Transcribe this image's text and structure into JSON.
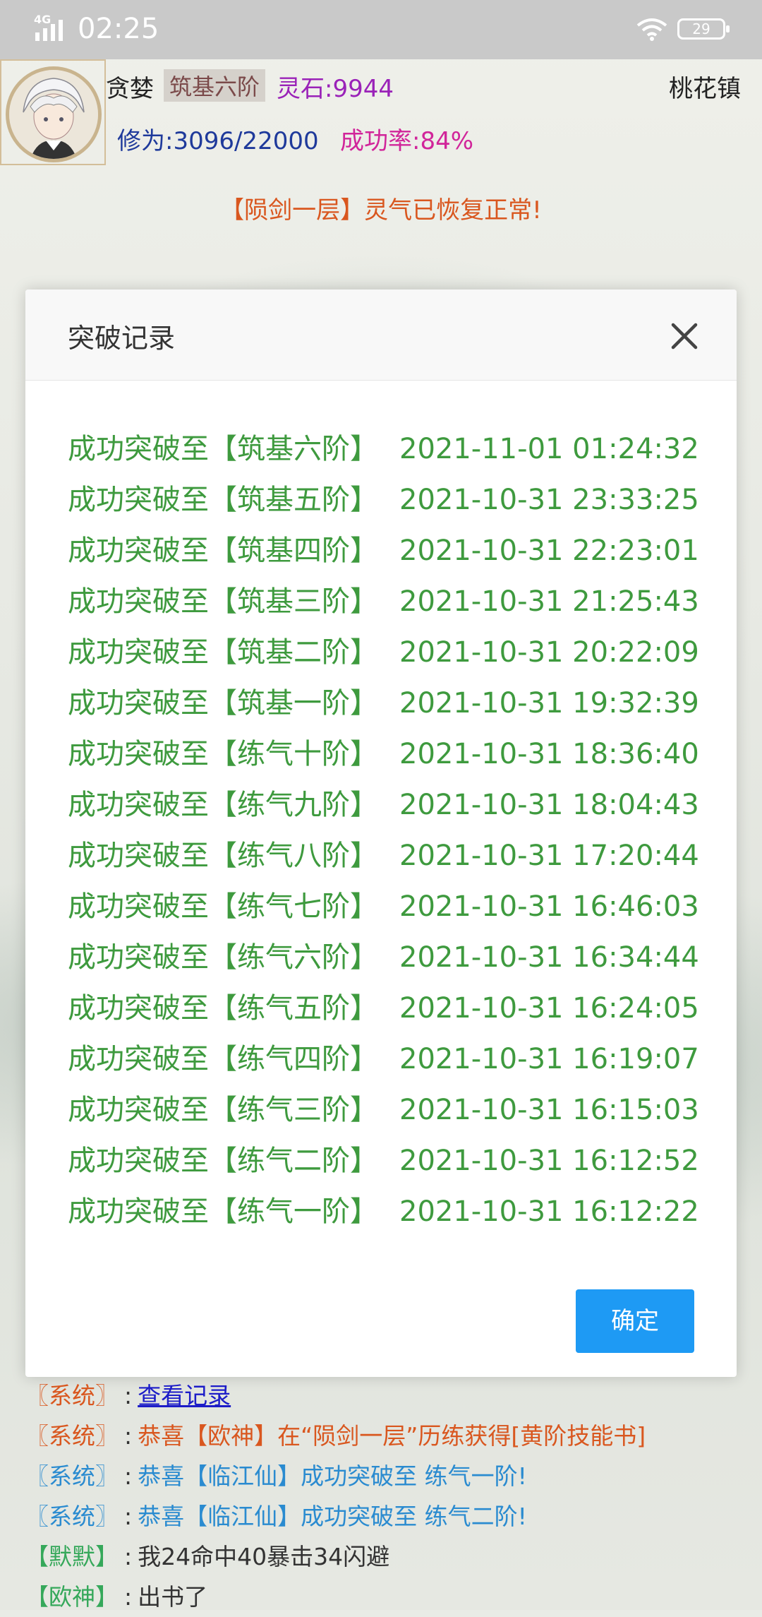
{
  "status_bar": {
    "network": "4G",
    "time": "02:25",
    "battery": "29"
  },
  "header": {
    "player_name": "贪婪",
    "realm": "筑基六阶",
    "spirit_stones": "灵石:9944",
    "location": "桃花镇",
    "cultivation": "修为:3096/22000",
    "success_rate": "成功率:84%"
  },
  "notice": "【陨剑一层】灵气已恢复正常!",
  "modal": {
    "title": "突破记录",
    "ok_label": "确定",
    "records": [
      {
        "text": "成功突破至【筑基六阶】",
        "time": "2021-11-01 01:24:32"
      },
      {
        "text": "成功突破至【筑基五阶】",
        "time": "2021-10-31 23:33:25"
      },
      {
        "text": "成功突破至【筑基四阶】",
        "time": "2021-10-31 22:23:01"
      },
      {
        "text": "成功突破至【筑基三阶】",
        "time": "2021-10-31 21:25:43"
      },
      {
        "text": "成功突破至【筑基二阶】",
        "time": "2021-10-31 20:22:09"
      },
      {
        "text": "成功突破至【筑基一阶】",
        "time": "2021-10-31 19:32:39"
      },
      {
        "text": "成功突破至【练气十阶】",
        "time": "2021-10-31 18:36:40"
      },
      {
        "text": "成功突破至【练气九阶】",
        "time": "2021-10-31 18:04:43"
      },
      {
        "text": "成功突破至【练气八阶】",
        "time": "2021-10-31 17:20:44"
      },
      {
        "text": "成功突破至【练气七阶】",
        "time": "2021-10-31 16:46:03"
      },
      {
        "text": "成功突破至【练气六阶】",
        "time": "2021-10-31 16:34:44"
      },
      {
        "text": "成功突破至【练气五阶】",
        "time": "2021-10-31 16:24:05"
      },
      {
        "text": "成功突破至【练气四阶】",
        "time": "2021-10-31 16:19:07"
      },
      {
        "text": "成功突破至【练气三阶】",
        "time": "2021-10-31 16:15:03"
      },
      {
        "text": "成功突破至【练气二阶】",
        "time": "2021-10-31 16:12:52"
      },
      {
        "text": "成功突破至【练气一阶】",
        "time": "2021-10-31 16:12:22"
      }
    ]
  },
  "chat": [
    {
      "tag": "〖系统〗",
      "sep": ":",
      "msg": "查看记录"
    },
    {
      "tag": "〖系统〗",
      "sep": ":",
      "msg": "恭喜【欧神】在“陨剑一层”历练获得[黄阶技能书]"
    },
    {
      "tag": "〖系统〗",
      "sep": ":",
      "msg": "恭喜【临江仙】成功突破至 练气一阶!"
    },
    {
      "tag": "〖系统〗",
      "sep": ":",
      "msg": "恭喜【临江仙】成功突破至 练气二阶!"
    },
    {
      "tag": "【默默】",
      "sep": ":",
      "msg": "我24命中40暴击34闪避"
    },
    {
      "tag": "【欧神】",
      "sep": ":",
      "msg": "出书了"
    }
  ]
}
